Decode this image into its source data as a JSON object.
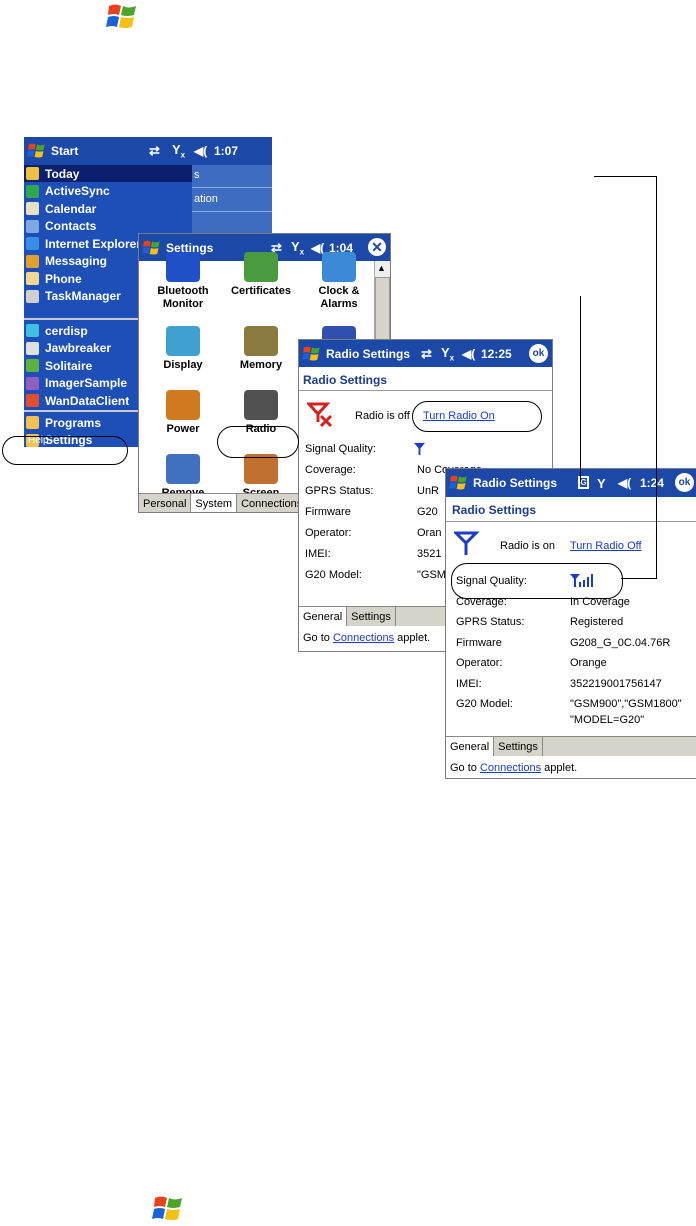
{
  "colors": {
    "titlebar": "#1c48a8",
    "start_menu_bg": "#1d4fb6",
    "highlight": "#0a1f6e",
    "tab_bg": "#d6d3c8",
    "link": "#1c3cc8"
  },
  "screen1": {
    "title": "Start",
    "time": "1:07",
    "status_icons": [
      "sync-arrows-icon",
      "antenna-off-icon",
      "speaker-icon"
    ],
    "menu_top": [
      {
        "label": "Today",
        "icon": "today-icon"
      },
      {
        "label": "ActiveSync",
        "icon": "activesync-icon"
      },
      {
        "label": "Calendar",
        "icon": "calendar-icon"
      },
      {
        "label": "Contacts",
        "icon": "contacts-icon"
      },
      {
        "label": "Internet Explorer",
        "icon": "ie-icon"
      },
      {
        "label": "Messaging",
        "icon": "messaging-icon"
      },
      {
        "label": "Phone",
        "icon": "phone-icon"
      },
      {
        "label": "TaskManager",
        "icon": "taskmanager-icon"
      }
    ],
    "menu_recent": [
      {
        "label": "cerdisp",
        "icon": "cerdisp-icon"
      },
      {
        "label": "Jawbreaker",
        "icon": "jawbreaker-icon"
      },
      {
        "label": "Solitaire",
        "icon": "solitaire-icon"
      },
      {
        "label": "ImagerSample",
        "icon": "imager-icon"
      },
      {
        "label": "WanDataClient",
        "icon": "wan-icon"
      }
    ],
    "menu_bottom": [
      {
        "label": "Programs",
        "icon": "programs-folder-icon"
      },
      {
        "label": "Settings",
        "icon": "settings-folder-icon"
      }
    ],
    "bg_fragment_1": "s",
    "bg_fragment_2": "ation",
    "bg_fragment_3": "Help"
  },
  "screen2": {
    "title": "Settings",
    "time": "1:04",
    "grid": [
      {
        "label": "Bluetooth\nMonitor",
        "icon": "bluetooth-icon"
      },
      {
        "label": "Certificates",
        "icon": "certificates-icon"
      },
      {
        "label": "Clock &\nAlarms",
        "icon": "clock-icon"
      },
      {
        "label": "Display",
        "icon": "display-icon"
      },
      {
        "label": "Memory",
        "icon": "memory-icon"
      },
      {
        "label": "",
        "icon": "system-info-icon"
      },
      {
        "label": "Power",
        "icon": "power-icon"
      },
      {
        "label": "Radio",
        "icon": "radio-icon"
      },
      {
        "label": "",
        "icon": ""
      },
      {
        "label": "Remove",
        "icon": "remove-programs-icon"
      },
      {
        "label": "Screen",
        "icon": "screen-icon"
      },
      {
        "label": "",
        "icon": ""
      }
    ],
    "tabs": [
      "Personal",
      "System",
      "Connections"
    ]
  },
  "screen3": {
    "title": "Radio Settings",
    "time": "12:25",
    "ok": "ok",
    "heading": "Radio Settings",
    "radio_status": "Radio is off",
    "radio_link": "Turn Radio On",
    "rows": [
      {
        "label": "Signal Quality:",
        "value": ""
      },
      {
        "label": "Coverage:",
        "value": "No Coverage"
      },
      {
        "label": "GPRS Status:",
        "value": "UnR"
      },
      {
        "label": "Firmware",
        "value": "G20"
      },
      {
        "label": "Operator:",
        "value": "Oran"
      },
      {
        "label": "IMEI:",
        "value": "3521"
      },
      {
        "label": "G20 Model:",
        "value": "\"GSM"
      }
    ],
    "tabs": [
      "General",
      "Settings"
    ],
    "footer_prefix": "Go to ",
    "footer_link": "Connections",
    "footer_suffix": " applet."
  },
  "screen4": {
    "title": "Radio Settings",
    "time": "1:24",
    "ok": "ok",
    "heading": "Radio Settings",
    "radio_status": "Radio is on",
    "radio_link": "Turn Radio Off",
    "rows": [
      {
        "label": "Signal Quality:",
        "value": ""
      },
      {
        "label": "Coverage:",
        "value": "In Coverage"
      },
      {
        "label": "GPRS Status:",
        "value": "Registered"
      },
      {
        "label": "Firmware",
        "value": "G208_G_0C.04.76R"
      },
      {
        "label": "Operator:",
        "value": "Orange"
      },
      {
        "label": "IMEI:",
        "value": "352219001756147"
      },
      {
        "label": "G20 Model:",
        "value": "\"GSM900\",\"GSM1800\""
      },
      {
        "label": "",
        "value": "\"MODEL=G20\""
      }
    ],
    "tabs": [
      "General",
      "Settings"
    ],
    "footer_prefix": "Go to ",
    "footer_link": "Connections",
    "footer_suffix": " applet."
  }
}
